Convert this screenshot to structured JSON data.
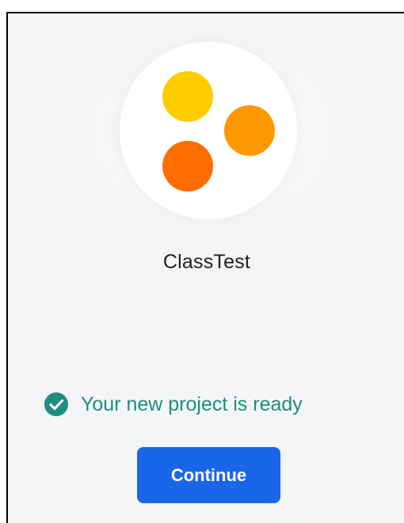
{
  "project": {
    "name": "ClassTest",
    "logo": {
      "icon": "project-logo-dots",
      "colors": [
        "#ffcc00",
        "#ff9800",
        "#ff6d00"
      ]
    }
  },
  "status": {
    "icon": "check-circle-icon",
    "text": "Your new project is ready",
    "color": "#1e8e7e"
  },
  "actions": {
    "continue_label": "Continue",
    "button_color": "#1a66e8"
  }
}
